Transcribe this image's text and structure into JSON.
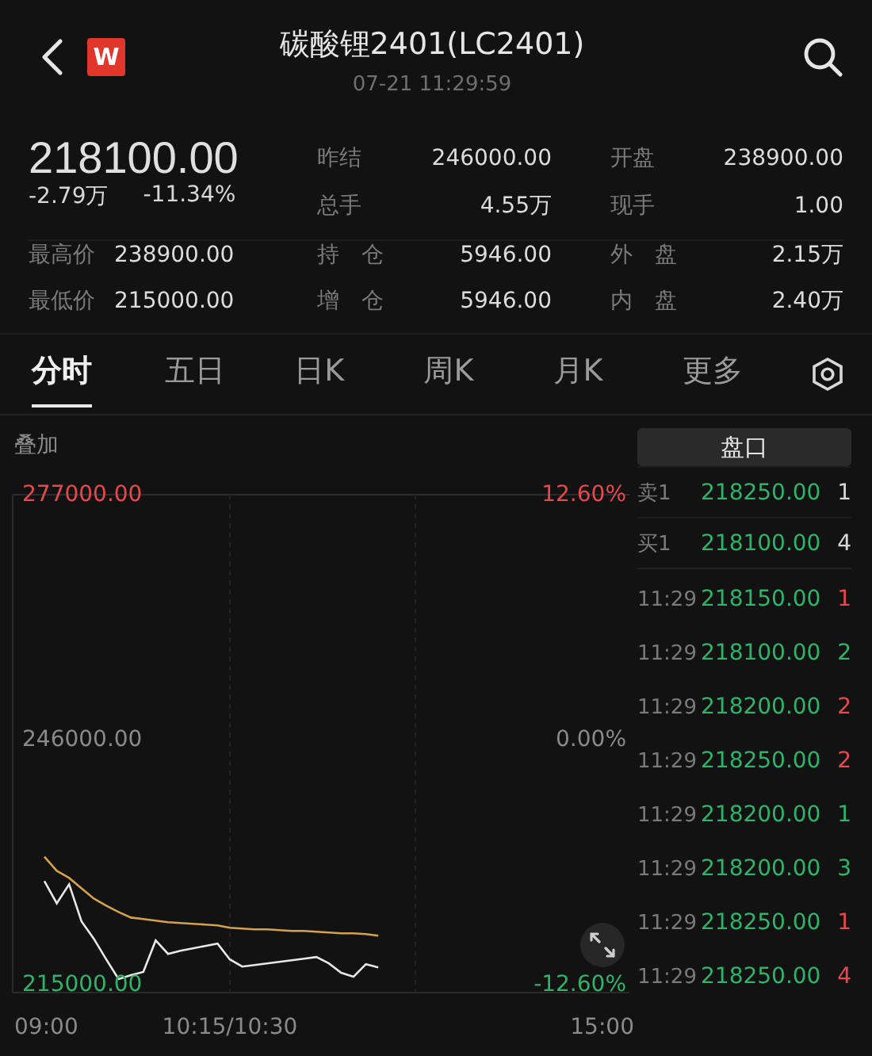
{
  "header": {
    "logo": "W",
    "title": "碳酸锂2401(LC2401)",
    "timestamp": "07-21 11:29:59"
  },
  "quote": {
    "price": "218100.00",
    "change": "-2.79万",
    "change_pct": "-11.34%"
  },
  "stats_top": [
    {
      "label": "昨结",
      "value": "246000.00"
    },
    {
      "label": "开盘",
      "value": "238900.00"
    },
    {
      "label": "总手",
      "value": "4.55万"
    },
    {
      "label": "现手",
      "value": "1.00"
    }
  ],
  "stats_bottom": [
    {
      "label": "最高价",
      "value": "238900.00"
    },
    {
      "label": "持　仓",
      "value": "5946.00"
    },
    {
      "label": "外　盘",
      "value": "2.15万"
    },
    {
      "label": "最低价",
      "value": "215000.00"
    },
    {
      "label": "增　仓",
      "value": "5946.00"
    },
    {
      "label": "内　盘",
      "value": "2.40万"
    }
  ],
  "tabs": [
    {
      "label": "分时",
      "selected": true
    },
    {
      "label": "五日",
      "selected": false
    },
    {
      "label": "日K",
      "selected": false
    },
    {
      "label": "周K",
      "selected": false
    },
    {
      "label": "月K",
      "selected": false
    },
    {
      "label": "更多",
      "selected": false
    }
  ],
  "chart": {
    "overlay_label": "叠加",
    "right_labels": [
      {
        "text": "12.60%",
        "color": "#e5484d"
      },
      {
        "text": "0.00%",
        "color": "#8a8a8a"
      },
      {
        "text": "-12.60%",
        "color": "#2fb36a"
      }
    ],
    "chart_data": {
      "type": "line",
      "categories": [
        "09:00",
        null,
        null,
        null,
        null,
        null,
        null,
        null,
        null,
        null,
        null,
        null,
        null,
        null,
        null,
        "10:15/10:30",
        null,
        null,
        null,
        null,
        null,
        null,
        null,
        null,
        null,
        null,
        null,
        null,
        null,
        null,
        null,
        null,
        null,
        null,
        null,
        null,
        null,
        null,
        null,
        null,
        null,
        null,
        null,
        null,
        null,
        "15:00"
      ],
      "series": [
        {
          "color": "#e8e8e8",
          "values": [
            228100,
            225300,
            227700,
            223000,
            220800,
            218200,
            215700,
            216200,
            216600,
            220600,
            218900,
            219300,
            219600,
            219900,
            220200,
            218200,
            217300,
            217500,
            217700,
            217900,
            218100,
            218300,
            218500,
            217700,
            216500,
            216000,
            217600,
            217200,
            null,
            null,
            null,
            null,
            null,
            null,
            null,
            null,
            null,
            null,
            null,
            null,
            null,
            null,
            null,
            null,
            null,
            null
          ]
        },
        {
          "color": "#d4a24c",
          "values": [
            231200,
            229400,
            228500,
            227200,
            225900,
            225000,
            224200,
            223500,
            223300,
            223100,
            222900,
            222800,
            222700,
            222600,
            222500,
            222200,
            222100,
            222000,
            222000,
            221900,
            221800,
            221800,
            221700,
            221600,
            221500,
            221500,
            221400,
            221200,
            null,
            null,
            null,
            null,
            null,
            null,
            null,
            null,
            null,
            null,
            null,
            null,
            null,
            null,
            null,
            null,
            null,
            null
          ]
        }
      ],
      "ylim": [
        214000,
        277000
      ],
      "yticks": [
        {
          "value": 277000,
          "label": "277000.00"
        },
        {
          "value": 246000,
          "label": "246000.00"
        },
        {
          "value": 215000,
          "label": "215000.00"
        }
      ]
    }
  },
  "book_title": "盘口",
  "book": [
    {
      "label": "卖1",
      "price": "218250.00",
      "volume": "1"
    },
    {
      "label": "买1",
      "price": "218100.00",
      "volume": "4"
    }
  ],
  "trades": [
    {
      "time": "11:29",
      "price": "218150.00",
      "volume": "1",
      "color": "#e5484d"
    },
    {
      "time": "11:29",
      "price": "218100.00",
      "volume": "2",
      "color": "#2fb36a"
    },
    {
      "time": "11:29",
      "price": "218200.00",
      "volume": "2",
      "color": "#e5484d"
    },
    {
      "time": "11:29",
      "price": "218250.00",
      "volume": "2",
      "color": "#e5484d"
    },
    {
      "time": "11:29",
      "price": "218200.00",
      "volume": "1",
      "color": "#2fb36a"
    },
    {
      "time": "11:29",
      "price": "218200.00",
      "volume": "3",
      "color": "#2fb36a"
    },
    {
      "time": "11:29",
      "price": "218250.00",
      "volume": "1",
      "color": "#e5484d"
    },
    {
      "time": "11:29",
      "price": "218250.00",
      "volume": "4",
      "color": "#e5484d"
    }
  ]
}
